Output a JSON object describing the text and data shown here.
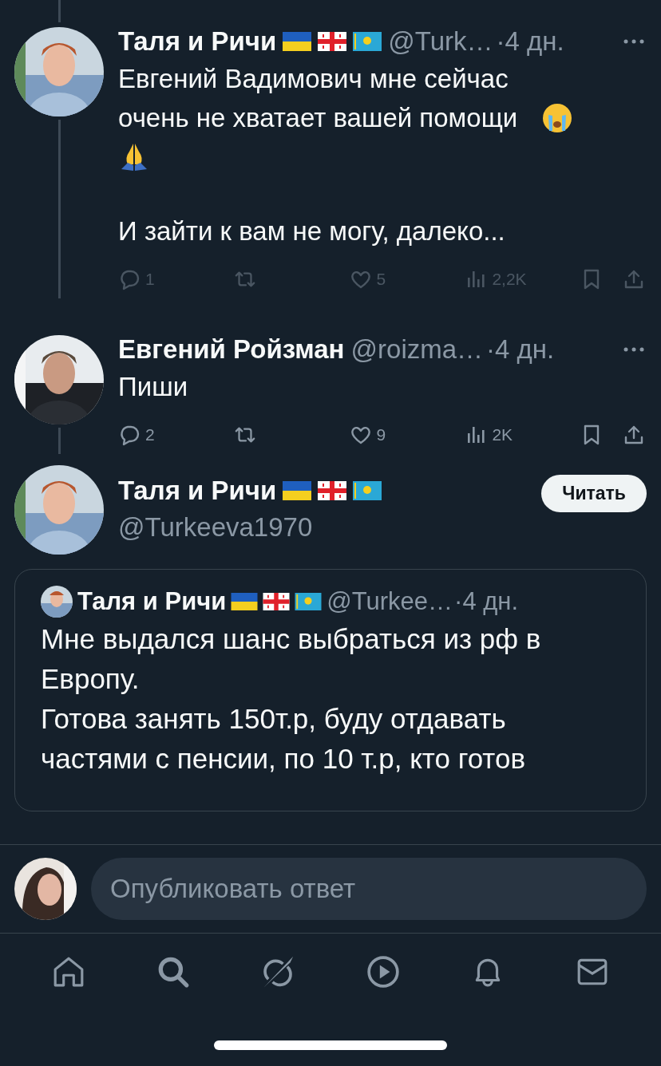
{
  "thread": [
    {
      "author": {
        "name": "Таля и Ричи",
        "flags": true,
        "handle": "@Turk…",
        "time": "·4 дн."
      },
      "paragraphs": [
        {
          "kind": "text-emoji",
          "text": "Евгений Вадимович мне сейчас очень не хватает вашей помощи"
        },
        {
          "kind": "text",
          "text": "И зайти к вам не могу, далеко..."
        }
      ],
      "actions_dimmed": true,
      "actions": [
        {
          "kind": "reply",
          "count": "1"
        },
        {
          "kind": "retweet"
        },
        {
          "kind": "like",
          "count": "5"
        },
        {
          "kind": "views",
          "count": "2,2K"
        },
        {
          "kind": "bookmark"
        },
        {
          "kind": "share"
        }
      ]
    },
    {
      "author": {
        "name": "Евгений Ройзман",
        "flags": false,
        "handle": "@roizma…",
        "time": "·4 дн."
      },
      "paragraphs": [
        {
          "kind": "text",
          "text": "Пиши"
        }
      ],
      "actions_dimmed": false,
      "actions": [
        {
          "kind": "reply",
          "count": "2"
        },
        {
          "kind": "retweet"
        },
        {
          "kind": "like",
          "count": "9"
        },
        {
          "kind": "views",
          "count": "2K"
        },
        {
          "kind": "bookmark"
        },
        {
          "kind": "share"
        }
      ]
    }
  ],
  "focused": {
    "author": {
      "name": "Таля и Ричи",
      "flags": true,
      "handle": "@Turkeeva1970"
    },
    "follow_button": "Читать",
    "quote": {
      "author": {
        "name": "Таля и Ричи",
        "flags": true,
        "handle": "@Turkee…",
        "time": "·4 дн."
      },
      "lines": [
        "Мне выдался шанс выбраться из рф в Европу.",
        "Готова занять 150т.р, буду отдавать частями с пенсии, по 10 т.р, кто готов"
      ]
    }
  },
  "composer": {
    "placeholder": "Опубликовать ответ"
  },
  "nav": [
    {
      "kind": "home"
    },
    {
      "kind": "search"
    },
    {
      "kind": "grok"
    },
    {
      "kind": "video"
    },
    {
      "kind": "notifications"
    },
    {
      "kind": "messages"
    }
  ]
}
